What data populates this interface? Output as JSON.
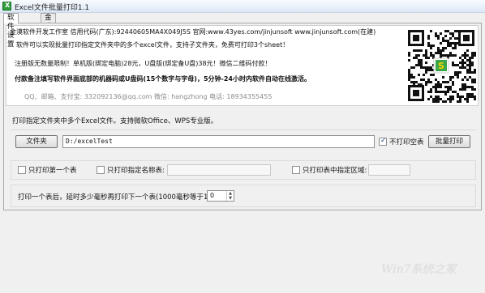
{
  "window": {
    "title": "Excel文件批量打印1.1"
  },
  "tabs": [
    {
      "label": "软件设置"
    },
    {
      "label": "金漠软件"
    }
  ],
  "info": {
    "company_line": "金漠软件开发工作室  信用代码(广东):92440605MA4X049J5S  官网:www.43yes.com/jinjunsoft  www.jinjunsoft.com(在建)",
    "line1": "软件可以实现批量打印指定文件夹中的多个excel文件，支持子文件夹，免费可打印3个sheet！",
    "line2": "注册版无数量限制！单机版(绑定电脑)28元，U盘版(绑定备U盘)38元！微信二维码付款！",
    "line3": "付款备注填写软件界面底部的机器码或U盘码(15个数字与字母)，5分钟-24小时内软件自动在线激活。",
    "contact": "QQ、邮箱、支付宝: 332092136@qq.com   微信: hangzhong   电话: 18934355455"
  },
  "main": {
    "description": "打印指定文件夹中多个Excel文件。支持微软Office、WPS专业版。",
    "folder_button": "文件夹",
    "folder_path": "D:/excelTest",
    "skip_empty_label": "不打印空表",
    "skip_empty_checked": true,
    "batch_print_button": "批量打印",
    "first_sheet_only_label": "只打印第一个表",
    "first_sheet_only_checked": false,
    "named_sheet_label": "只打印指定名称表:",
    "named_sheet_checked": false,
    "named_sheet_value": "",
    "print_area_label": "只打印表中指定区域:",
    "print_area_checked": false,
    "print_area_value": "",
    "delay_label": "打印一个表后，延时多少毫秒再打印下一个表(1000毫秒等于1秒):",
    "delay_value": "0"
  },
  "watermark": "Win7系统之家"
}
